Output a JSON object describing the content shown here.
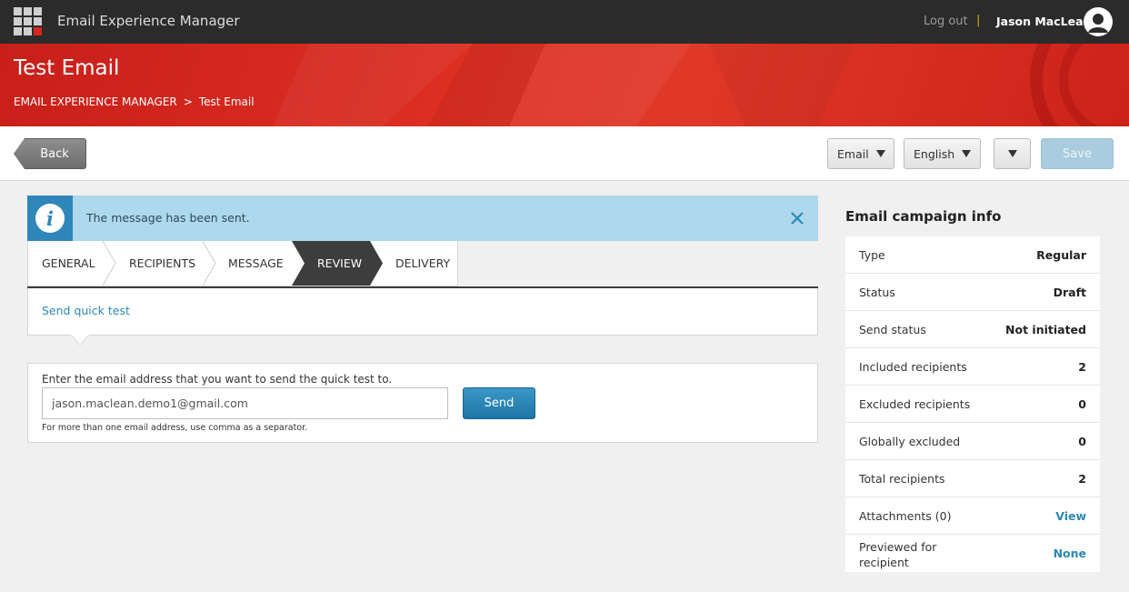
{
  "topbar": {
    "app_title": "Email Experience Manager",
    "logout_label": "Log out",
    "separator": "|",
    "username": "Jason MacLean"
  },
  "header": {
    "page_title": "Test Email",
    "breadcrumb": {
      "root": "EMAIL EXPERIENCE MANAGER",
      "chevron": ">",
      "current": "Test Email"
    }
  },
  "toolbar": {
    "back_label": "Back",
    "email_dropdown_label": "Email",
    "language_dropdown_label": "English",
    "save_label": "Save"
  },
  "notice": {
    "icon_glyph": "i",
    "message": "The message has been sent."
  },
  "wizard": {
    "tabs": [
      {
        "label": "GENERAL",
        "active": false
      },
      {
        "label": "RECIPIENTS",
        "active": false
      },
      {
        "label": "MESSAGE",
        "active": false
      },
      {
        "label": "REVIEW",
        "active": true
      },
      {
        "label": "DELIVERY",
        "active": false
      }
    ]
  },
  "quick_test": {
    "link_label": "Send quick test",
    "prompt": "Enter the email address that you want to send the quick test to.",
    "email_value": "jason.maclean.demo1@gmail.com",
    "send_label": "Send",
    "hint": "For more than one email address, use comma as a separator."
  },
  "campaign_info": {
    "title": "Email campaign info",
    "rows": [
      {
        "label": "Type",
        "value": "Regular",
        "link": false
      },
      {
        "label": "Status",
        "value": "Draft",
        "link": false
      },
      {
        "label": "Send status",
        "value": "Not initiated",
        "link": false
      },
      {
        "label": "Included recipients",
        "value": "2",
        "link": false
      },
      {
        "label": "Excluded recipients",
        "value": "0",
        "link": false
      },
      {
        "label": "Globally excluded",
        "value": "0",
        "link": false
      },
      {
        "label": "Total recipients",
        "value": "2",
        "link": false
      },
      {
        "label": "Attachments (0)",
        "value": "View",
        "link": true
      },
      {
        "label": "Previewed for recipient",
        "value": "None",
        "link": true
      }
    ]
  },
  "colors": {
    "topbar_bg": "#2b2b2b",
    "header_red": "#dd2e22",
    "accent_blue": "#2c88b6",
    "notice_bg": "#aed8ec",
    "active_tab": "#3d3d3d",
    "save_disabled": "#a9ccde"
  },
  "icons": {
    "app_launcher": "app-grid-icon",
    "avatar": "user-avatar-icon",
    "info": "info-icon",
    "close": "close-icon",
    "dropdown": "caret-down-icon"
  }
}
